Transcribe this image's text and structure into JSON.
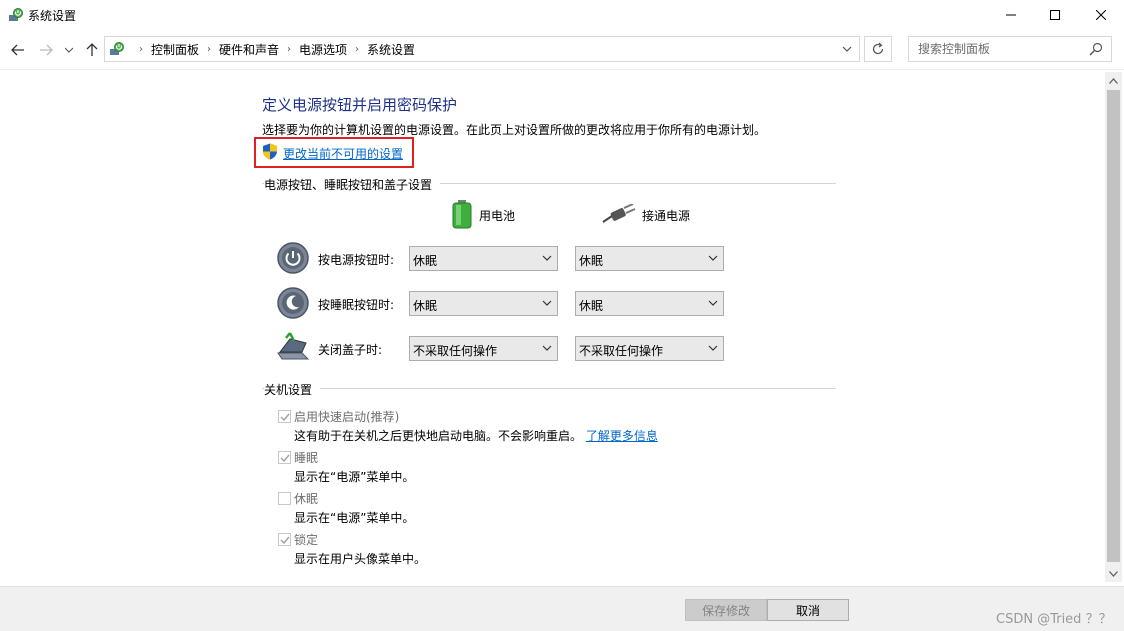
{
  "window": {
    "title": "系统设置",
    "app_icon": "power-options-icon",
    "controls": [
      "minimize-icon",
      "maximize-icon",
      "close-icon"
    ]
  },
  "nav": {
    "breadcrumb": [
      "控制面板",
      "硬件和声音",
      "电源选项",
      "系统设置"
    ],
    "search_placeholder": "搜索控制面板"
  },
  "content": {
    "heading": "定义电源按钮并启用密码保护",
    "description": "选择要为你的计算机设置的电源设置。在此页上对设置所做的更改将应用于你所有的电源计划。",
    "admin_link": "更改当前不可用的设置",
    "buttons_section": {
      "title": "电源按钮、睡眠按钮和盖子设置",
      "col_battery": "用电池",
      "col_plugged": "接通电源",
      "rows": [
        {
          "label": "按电源按钮时:",
          "battery": "休眠",
          "plugged": "休眠",
          "icon": "power-button-icon"
        },
        {
          "label": "按睡眠按钮时:",
          "battery": "休眠",
          "plugged": "休眠",
          "icon": "sleep-button-icon"
        },
        {
          "label": "关闭盖子时:",
          "battery": "不采取任何操作",
          "plugged": "不采取任何操作",
          "icon": "laptop-lid-icon"
        }
      ]
    },
    "shutdown_section": {
      "title": "关机设置",
      "items": [
        {
          "label": "启用快速启动(推荐)",
          "checked": true,
          "desc": "这有助于在关机之后更快地启动电脑。不会影响重启。",
          "link": "了解更多信息"
        },
        {
          "label": "睡眠",
          "checked": true,
          "desc": "显示在“电源”菜单中。"
        },
        {
          "label": "休眠",
          "checked": false,
          "desc": "显示在“电源”菜单中。"
        },
        {
          "label": "锁定",
          "checked": true,
          "desc": "显示在用户头像菜单中。"
        }
      ]
    }
  },
  "footer": {
    "save": "保存修改",
    "cancel": "取消",
    "watermark": "CSDN @Tried ？？"
  },
  "colors": {
    "heading": "#1e3287",
    "link": "#0066cc",
    "highlight_box": "#e02020"
  }
}
